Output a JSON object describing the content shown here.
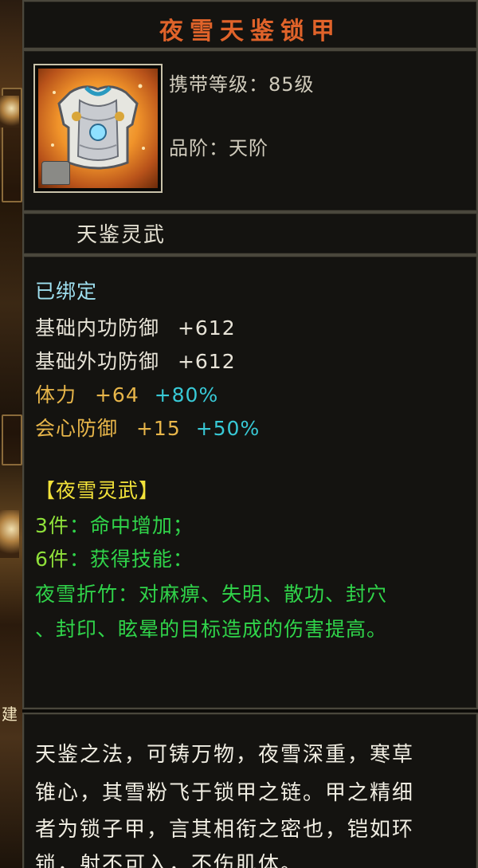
{
  "item": {
    "name": "夜雪天鉴锁甲",
    "level_line": "携带等级：85级",
    "grade_line": "品阶：天阶",
    "set_title": "天鉴灵武"
  },
  "stats": {
    "bound": "已绑定",
    "base_inner_defense": {
      "label": "基础内功防御",
      "value": "+612"
    },
    "base_outer_defense": {
      "label": "基础外功防御",
      "value": "+612"
    },
    "stamina": {
      "label": "体力",
      "value": "+64",
      "bonus": "+80%"
    },
    "crit_defense": {
      "label": "会心防御",
      "value": "+15",
      "bonus": "+50%"
    }
  },
  "set_bonus": {
    "name": "【夜雪灵武】",
    "piece3_count": "3件",
    "piece3_effect": "：命中增加；",
    "piece6_count": "6件",
    "piece6_effect": "：获得技能：",
    "skill_line1": "夜雪折竹：对麻痹、失明、散功、封穴",
    "skill_line2": "、封印、眩晕的目标造成的伤害提高。"
  },
  "lore": [
    "天鉴之法，可铸万物，夜雪深重，寒草",
    "锥心，其雪粉飞于锁甲之链。甲之精细",
    "者为锁子甲，言其相衔之密也，铠如环",
    "锁，射不可入，不伤肌体。"
  ],
  "left_strip_glyph": "建",
  "colors": {
    "title": "#e0632a",
    "bound": "#9fe0f0",
    "base_stat": "#e8e4d8",
    "bonus_stat": "#e8b64a",
    "percent": "#38c9d6",
    "set_name": "#f2e23a",
    "set_piece": "#8fe03a",
    "set_text": "#30d44a"
  }
}
